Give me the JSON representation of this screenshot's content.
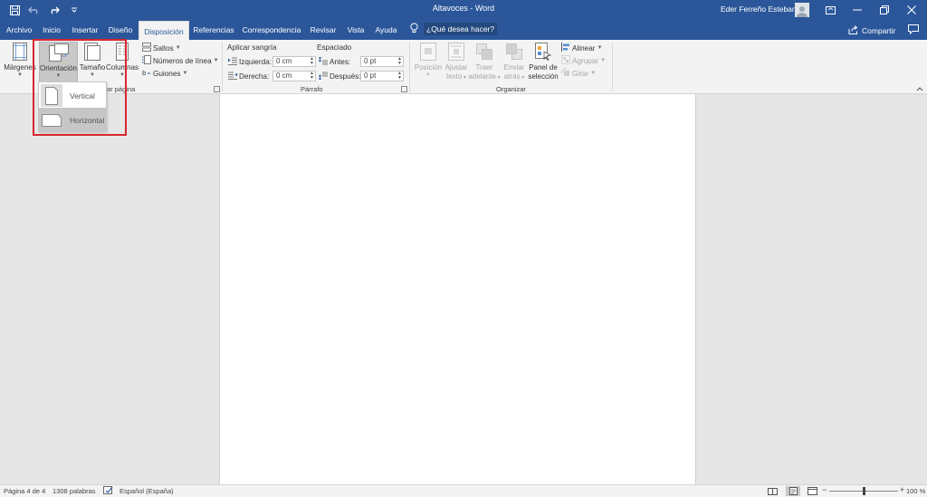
{
  "window": {
    "title": "Altavoces - Word",
    "user_name": "Eder Ferreño Esteban"
  },
  "tabs": [
    {
      "label": "Archivo",
      "active": false
    },
    {
      "label": "Inicio",
      "active": false
    },
    {
      "label": "Insertar",
      "active": false
    },
    {
      "label": "Diseño",
      "active": false
    },
    {
      "label": "Disposición",
      "active": true
    },
    {
      "label": "Referencias",
      "active": false
    },
    {
      "label": "Correspondencia",
      "active": false
    },
    {
      "label": "Revisar",
      "active": false
    },
    {
      "label": "Vista",
      "active": false
    },
    {
      "label": "Ayuda",
      "active": false
    }
  ],
  "tell_me": "¿Qué desea hacer?",
  "share_label": "Compartir",
  "ribbon": {
    "page_setup": {
      "margins": "Márgenes",
      "orientation": "Orientación",
      "size": "Tamaño",
      "columns": "Columnas",
      "breaks": "Saltos",
      "line_numbers": "Números de línea",
      "hyphenation": "Guiones",
      "group_label_visible": "ar página"
    },
    "paragraph": {
      "indent_header": "Aplicar sangría",
      "spacing_header": "Espaciado",
      "left_label": "Izquierda:",
      "left_value": "0 cm",
      "right_label": "Derecha:",
      "right_value": "0 cm",
      "before_label": "Antes:",
      "before_value": "0 pt",
      "after_label": "Después:",
      "after_value": "0 pt",
      "group_label": "Párrafo"
    },
    "arrange": {
      "position": [
        "Posición",
        ""
      ],
      "wrap_text": [
        "Ajustar",
        "texto"
      ],
      "bring_forward": [
        "Traer",
        "adelante"
      ],
      "send_backward": [
        "Enviar",
        "atrás"
      ],
      "selection_pane": [
        "Panel de",
        "selección"
      ],
      "align": "Alinear",
      "group": "Agrupar",
      "rotate": "Girar",
      "group_label": "Organizar"
    }
  },
  "orientation_menu": {
    "items": [
      {
        "label": "Vertical",
        "selected": false
      },
      {
        "label": "Horizontal",
        "selected": true
      }
    ]
  },
  "status": {
    "page": "Página 4 de 4",
    "words": "1308 palabras",
    "language": "Español (España)",
    "zoom": "100 %",
    "zoom_fraction": 0.5
  },
  "colors": {
    "accent": "#2b579a",
    "highlight": "#d8262e"
  }
}
